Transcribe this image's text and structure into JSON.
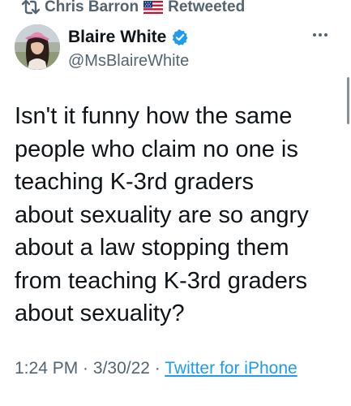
{
  "retweet": {
    "retweeter_name": "Chris Barron",
    "flag_icon": "us-flag-icon",
    "label": "Retweeted",
    "icon": "retweet-icon"
  },
  "author": {
    "name": "Blaire White",
    "handle": "@MsBlaireWhite",
    "verified": true,
    "verified_color": "#1d9bf0"
  },
  "tweet": {
    "text": "Isn't it funny how the same\npeople who claim no one is\nteaching K-3rd graders\nabout sexuality are so angry\nabout a law stopping them\nfrom teaching K-3rd graders\nabout sexuality?"
  },
  "meta": {
    "time": "1:24 PM",
    "date": "3/30/22",
    "separator": " · ",
    "source_label": "Twitter for iPhone",
    "link_color": "#1d9bf0"
  }
}
